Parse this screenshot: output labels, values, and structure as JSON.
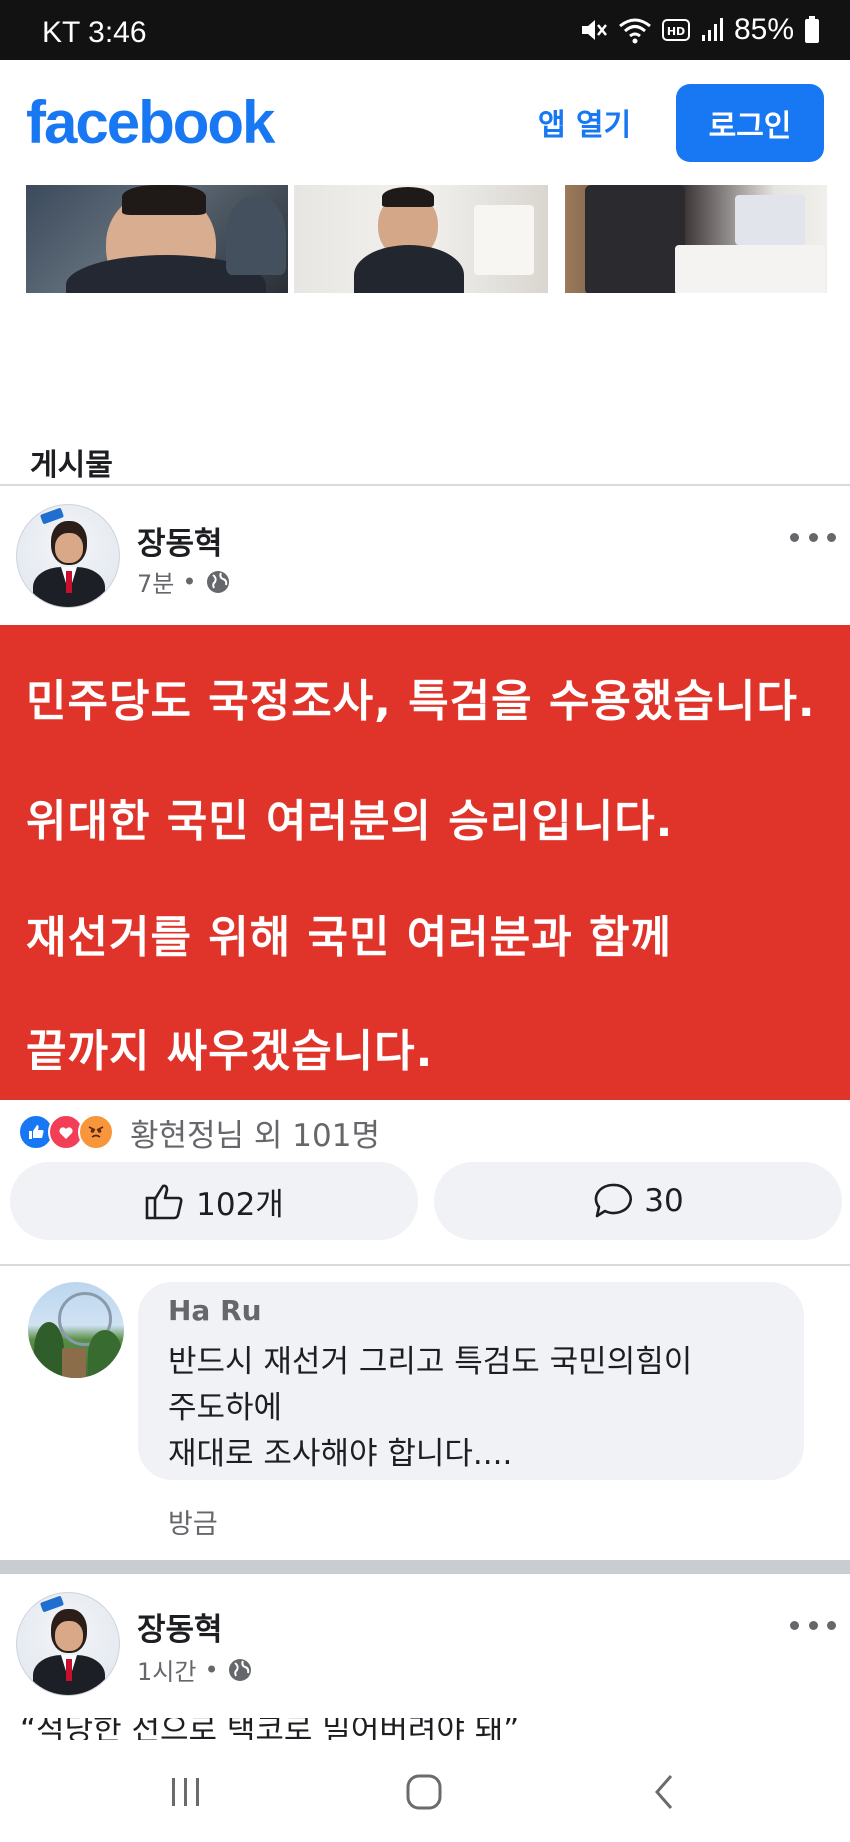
{
  "status_bar": {
    "carrier_time": "KT 3:46",
    "battery": "85%"
  },
  "header": {
    "logo": "facebook",
    "open_app": "앱 열기",
    "login": "로그인"
  },
  "section_title": "게시물",
  "post1": {
    "author": "장동혁",
    "time": "7분",
    "card_lines": [
      "민주당도 국정조사, 특검을 수용했습니다.",
      "위대한 국민 여러분의 승리입니다.",
      "재선거를 위해 국민 여러분과 함께",
      "끝까지 싸우겠습니다."
    ],
    "card_color": "#e0332a",
    "reaction_summary": "황현정님 외 101명",
    "like_count": "102개",
    "comment_count": "30"
  },
  "comment": {
    "author": "Ha Ru",
    "lines": [
      "반드시 재선거 그리고 특검도 국민의힘이",
      "주도하에",
      "재대로 조사해야 합니다...."
    ],
    "time": "방금"
  },
  "post2": {
    "author": "장동혁",
    "time": "1시간",
    "text": "“적당한 선으로 택코로 밀어버려야 돼”"
  },
  "colors": {
    "brand": "#1877f2",
    "status_bar": "#121212"
  }
}
